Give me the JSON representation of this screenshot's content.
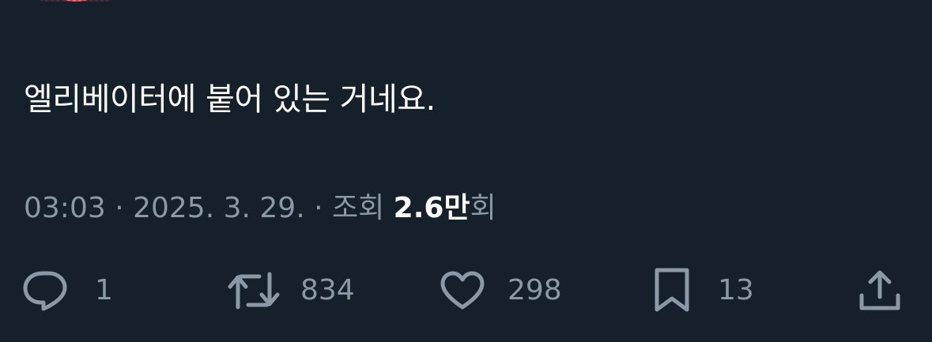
{
  "tweet": {
    "text": "엘리베이터에 붙어 있는 거네요."
  },
  "meta": {
    "time": "03:03",
    "sep1": " · ",
    "date": "2025. 3. 29.",
    "sep2": " · ",
    "views_label": "조회 ",
    "views_count": "2.6만",
    "views_suffix": "회"
  },
  "actions": {
    "replies": "1",
    "retweets": "834",
    "likes": "298",
    "bookmarks": "13"
  },
  "icons": {
    "reply": "reply-bubble-icon",
    "retweet": "retweet-arrows-icon",
    "like": "heart-icon",
    "bookmark": "bookmark-icon",
    "share": "share-upload-icon"
  },
  "colors": {
    "background": "#15202b",
    "text": "#ffffff",
    "secondary": "#8b98a5",
    "avatar": "#d95865"
  }
}
